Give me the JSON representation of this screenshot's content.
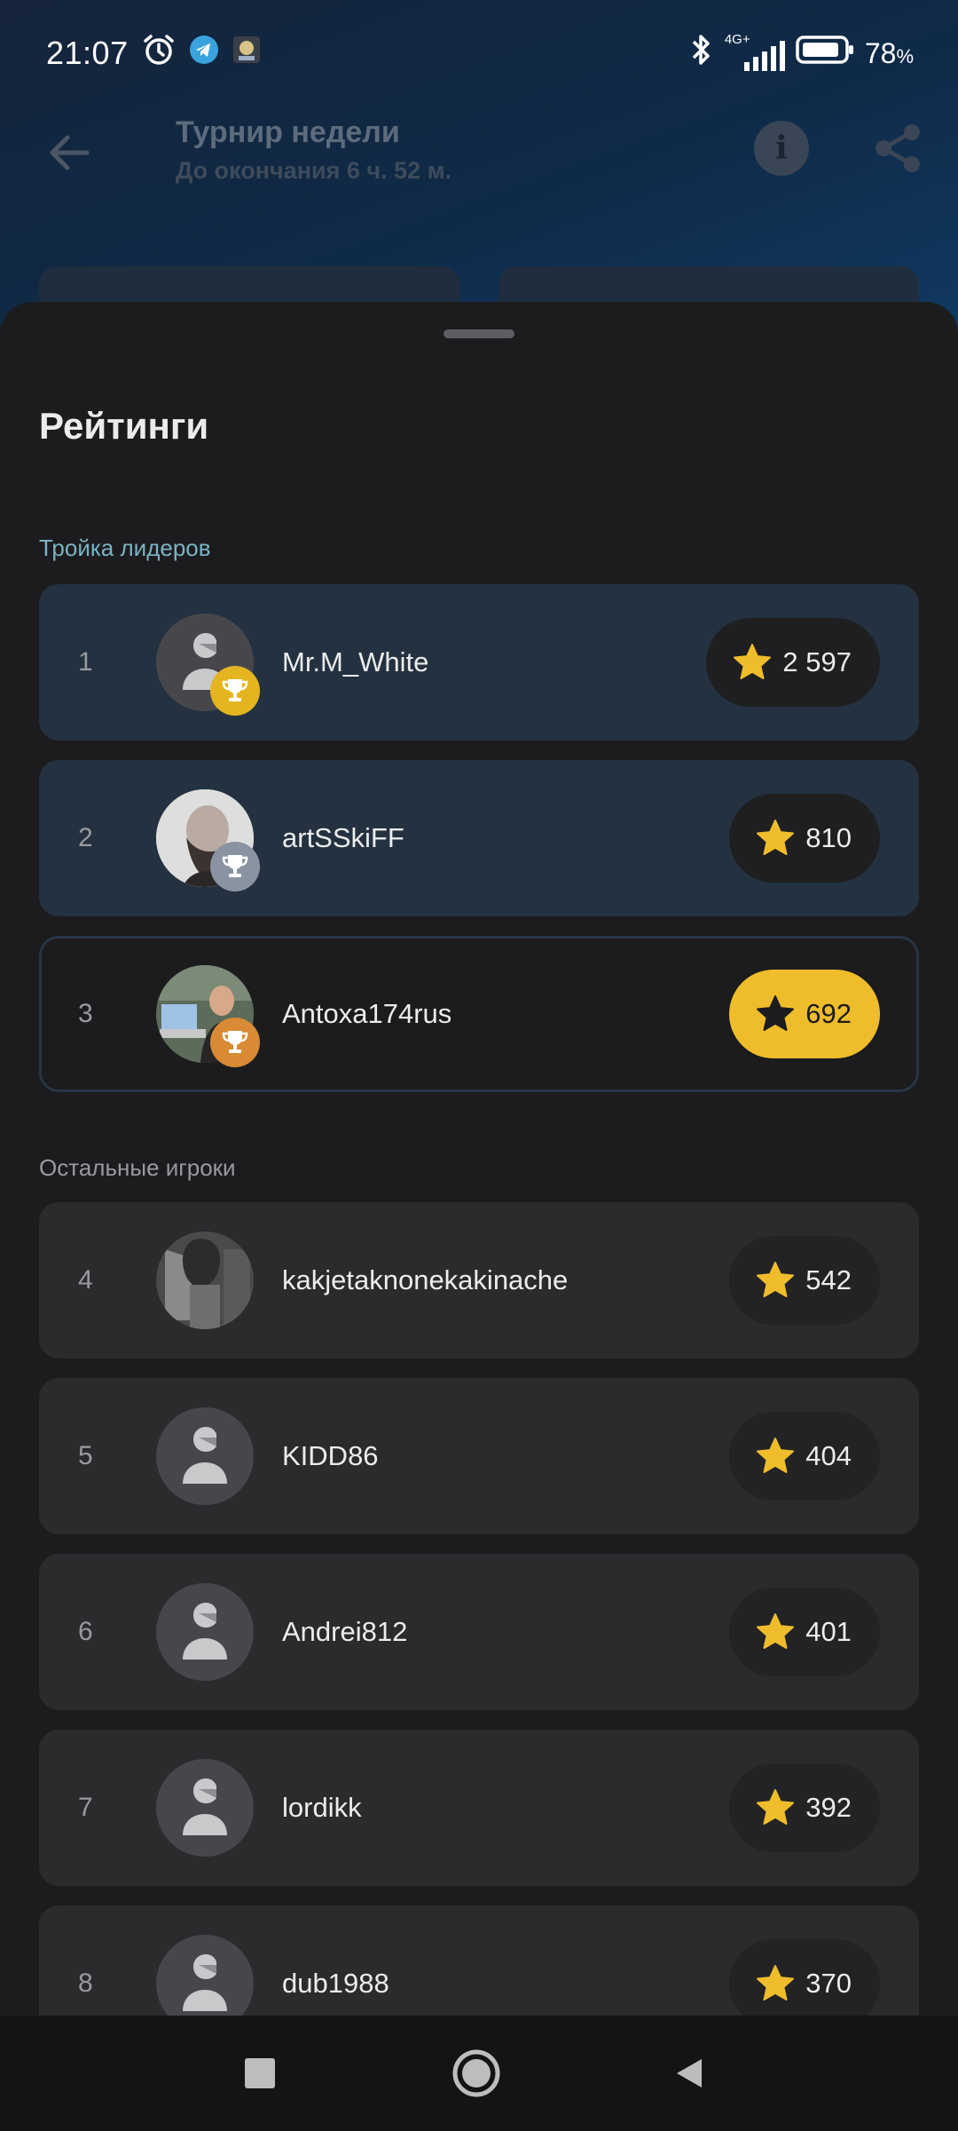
{
  "status_bar": {
    "time": "21:07",
    "network": "4G+",
    "battery": "78",
    "battery_unit": "%"
  },
  "app_bar": {
    "title": "Турнир недели",
    "subtitle": "До окончания 6 ч. 52 м."
  },
  "sheet": {
    "title": "Рейтинги",
    "leaders_label": "Тройка лидеров",
    "others_label": "Остальные игроки"
  },
  "players": [
    {
      "rank": "1",
      "name": "Mr.M_White",
      "score": "2 597",
      "trophy": "gold",
      "avatar": "default"
    },
    {
      "rank": "2",
      "name": "artSSkiFF",
      "score": "810",
      "trophy": "silver",
      "avatar": "photo-bearded-man"
    },
    {
      "rank": "3",
      "name": "Antoxa174rus",
      "score": "692",
      "trophy": "bronze",
      "avatar": "photo-man-at-laptop"
    },
    {
      "rank": "4",
      "name": "kakjetaknonekakinache",
      "score": "542",
      "avatar": "photo-dark"
    },
    {
      "rank": "5",
      "name": "KIDD86",
      "score": "404",
      "avatar": "default"
    },
    {
      "rank": "6",
      "name": "Andrei812",
      "score": "401",
      "avatar": "default"
    },
    {
      "rank": "7",
      "name": "lordikk",
      "score": "392",
      "avatar": "default"
    },
    {
      "rank": "8",
      "name": "dub1988",
      "score": "370",
      "avatar": "default"
    }
  ],
  "colors": {
    "accent_gold": "#efbd2c",
    "leader_row": "#243140",
    "row": "#2b2b2e",
    "leaders_label": "#7ab3c4"
  },
  "icons": {
    "back": "arrow-left-icon",
    "info": "info-icon",
    "share": "share-icon",
    "score": "star-icon",
    "trophy": "trophy-icon",
    "nav": [
      "square-recents-icon",
      "circle-home-icon",
      "triangle-back-icon"
    ]
  }
}
